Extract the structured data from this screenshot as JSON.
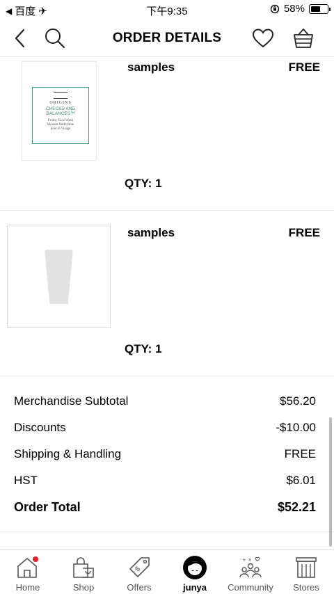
{
  "status_bar": {
    "carrier": "百度",
    "time": "下午9:35",
    "battery_percent": "58%",
    "battery_level": 0.58
  },
  "header": {
    "title": "ORDER DETAILS"
  },
  "items": [
    {
      "name": "samples",
      "price": "FREE",
      "quantity": "QTY: 1",
      "image": {
        "brand": "ORIGINS",
        "product": "CHECKS AND BALANCES™",
        "description_lines": [
          "Frothy Face Wash",
          "Mousse Nettoyante",
          "pour le Visage"
        ]
      }
    },
    {
      "name": "samples",
      "price": "FREE",
      "quantity": "QTY: 1"
    }
  ],
  "summary": {
    "rows": [
      {
        "label": "Merchandise Subtotal",
        "value": "$56.20"
      },
      {
        "label": "Discounts",
        "value": "-$10.00"
      },
      {
        "label": "Shipping & Handling",
        "value": "FREE"
      },
      {
        "label": "HST",
        "value": "$6.01"
      },
      {
        "label": "Order Total",
        "value": "$52.21"
      }
    ]
  },
  "tabs": [
    {
      "label": "Home",
      "icon": "home-icon",
      "badge": true
    },
    {
      "label": "Shop",
      "icon": "shopping-bag-icon"
    },
    {
      "label": "Offers",
      "icon": "tag-icon"
    },
    {
      "label": "junya",
      "icon": "profile-avatar-icon",
      "active": true
    },
    {
      "label": "Community",
      "icon": "community-icon"
    },
    {
      "label": "Stores",
      "icon": "store-icon"
    }
  ],
  "colors": {
    "accent_badge": "#e0202a",
    "divider": "#ececec",
    "origins_green": "#4a9a7b"
  }
}
